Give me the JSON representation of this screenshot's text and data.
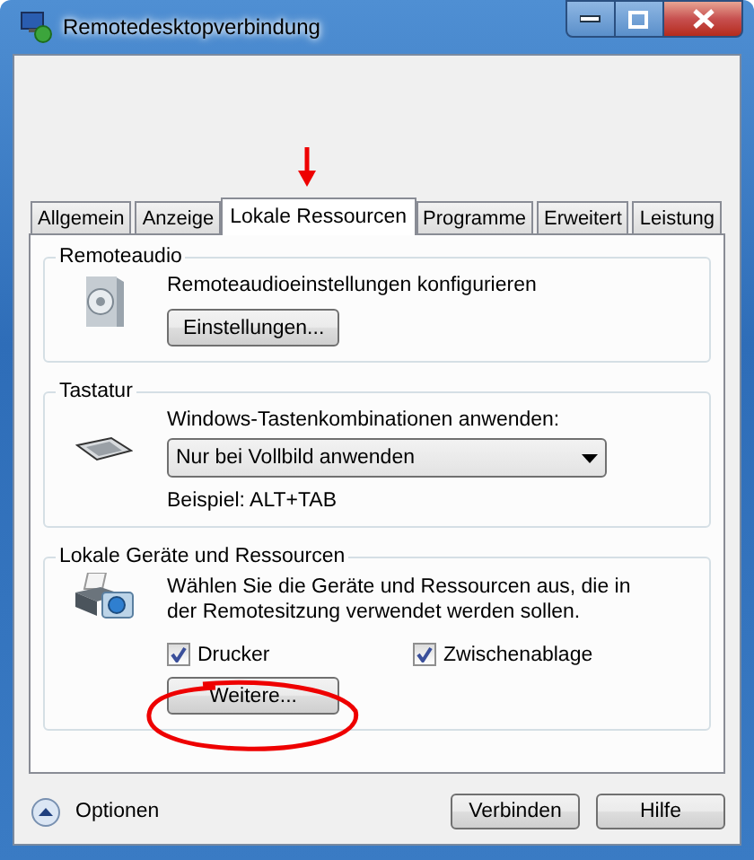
{
  "window": {
    "title": "Remotedesktopverbindung"
  },
  "tabs": [
    {
      "label": "Allgemein",
      "selected": false
    },
    {
      "label": "Anzeige",
      "selected": false
    },
    {
      "label": "Lokale Ressourcen",
      "selected": true
    },
    {
      "label": "Programme",
      "selected": false
    },
    {
      "label": "Erweitert",
      "selected": false
    },
    {
      "label": "Leistung",
      "selected": false
    }
  ],
  "groups": [
    {
      "kind": "audio",
      "title": "Remoteaudio",
      "description": "Remoteaudioeinstellungen konfigurieren",
      "button": "Einstellungen..."
    },
    {
      "kind": "keyboard",
      "title": "Tastatur",
      "label": "Windows-Tastenkombinationen anwenden:",
      "dropdown": {
        "value": "Nur bei Vollbild anwenden"
      },
      "example": "Beispiel: ALT+TAB"
    },
    {
      "kind": "devices",
      "title": "Lokale Geräte und Ressourcen",
      "description": "Wählen Sie die Geräte und Ressourcen aus, die in der Remotesitzung verwendet werden sollen.",
      "checkboxes": [
        {
          "label": "Drucker",
          "checked": true
        },
        {
          "label": "Zwischenablage",
          "checked": true
        }
      ],
      "button": "Weitere..."
    }
  ],
  "options": {
    "label": "Optionen"
  },
  "buttons": [
    "Verbinden",
    "Hilfe"
  ]
}
